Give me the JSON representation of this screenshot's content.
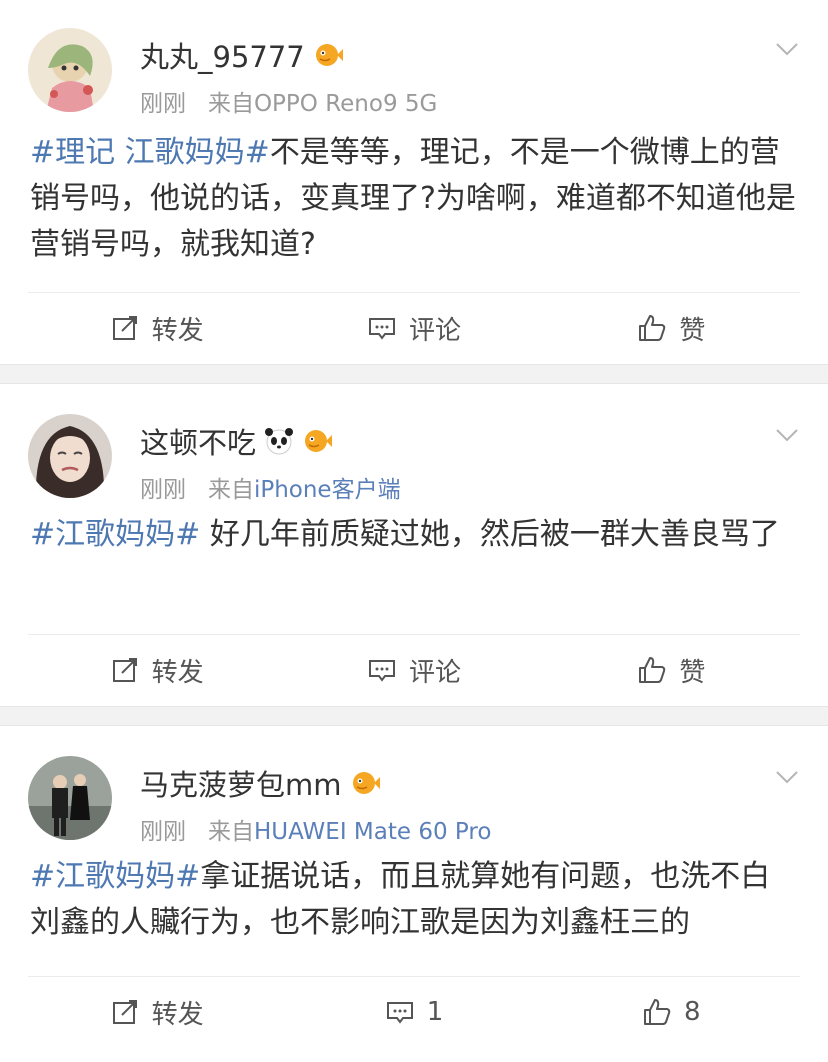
{
  "posts": [
    {
      "username": "丸丸_95777",
      "time": "刚刚",
      "source_prefix": "来自",
      "source_device": "OPPO Reno9 5G",
      "tag": "#理记 江歌妈妈#",
      "body": "不是等等，理记，不是一个微博上的营销号吗，他说的话，变真理了?为啥啊，难道都不知道他是营销号吗，就我知道?",
      "actions": {
        "repost": "转发",
        "comment": "评论",
        "like": "赞"
      }
    },
    {
      "username": "这顿不吃",
      "time": "刚刚",
      "source_prefix": "来自",
      "source_device": "iPhone客户端",
      "tag": "#江歌妈妈#",
      "body": " 好几年前质疑过她，然后被一群大善良骂了",
      "actions": {
        "repost": "转发",
        "comment": "评论",
        "like": "赞"
      }
    },
    {
      "username": "马克菠萝包mm",
      "time": "刚刚",
      "source_prefix": "来自",
      "source_device": "HUAWEI Mate 60 Pro",
      "tag": "#江歌妈妈#",
      "body": "拿证据说话，而且就算她有问题，也洗不白刘鑫的人贜行为，也不影响江歌是因为刘鑫枉三的",
      "actions": {
        "repost": "转发",
        "comment": "1",
        "like": "8"
      }
    }
  ],
  "icons": {
    "badge": "fish-badge-icon",
    "panda": "panda-emoji-icon",
    "chevron": "chevron-down-icon",
    "repost": "repost-icon",
    "comment": "comment-icon",
    "like": "thumbs-up-icon"
  },
  "colors": {
    "link": "#4d78b2",
    "meta": "#9a9a9a",
    "badge": "#f5a623"
  }
}
